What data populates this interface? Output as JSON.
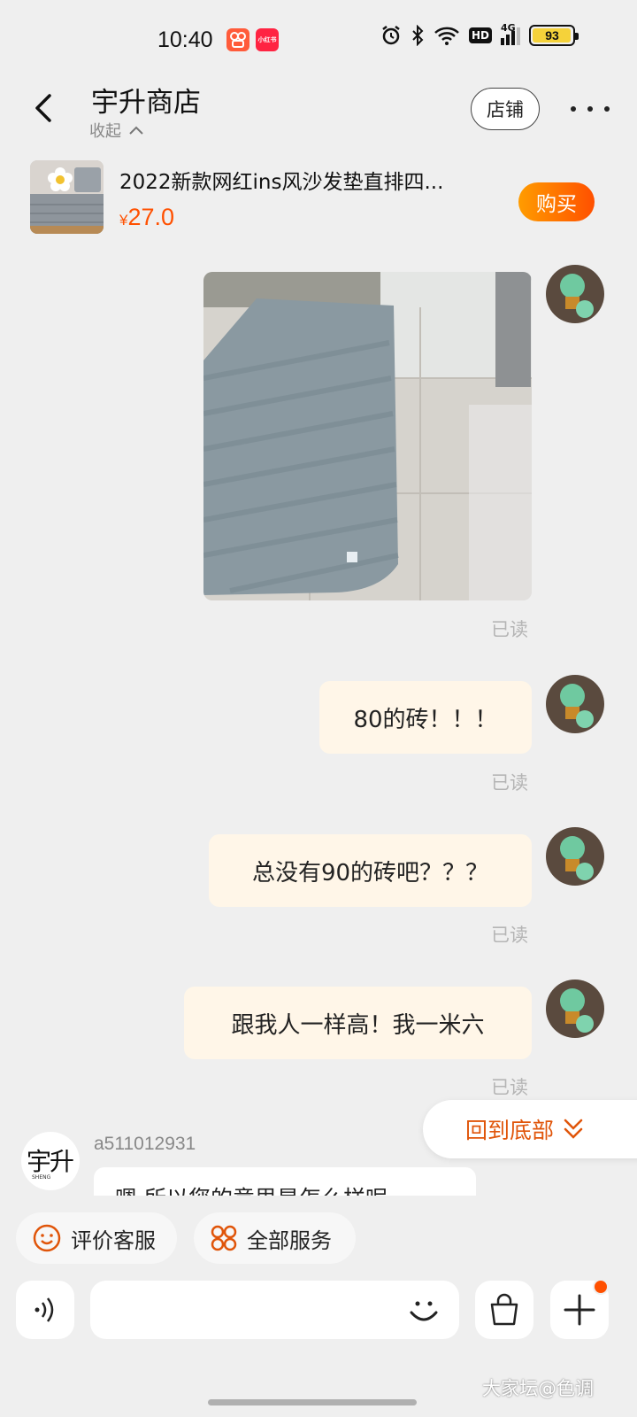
{
  "status_bar": {
    "time": "10:40",
    "battery": "93",
    "network": "4G",
    "hd_label": "HD",
    "app_icons": [
      "kuaishou-icon",
      "xiaohongshu-icon"
    ],
    "xiaohongshu_label": "小红书"
  },
  "header": {
    "title": "宇升商店",
    "collapse_label": "收起",
    "store_button": "店铺"
  },
  "product": {
    "title": "2022新款网红ins风沙发垫直排四...",
    "price_symbol": "¥",
    "price": "27.0",
    "buy_button": "购买"
  },
  "messages": [
    {
      "type": "image",
      "sender": "me",
      "status": "已读"
    },
    {
      "type": "text",
      "sender": "me",
      "text": "80的砖！！！",
      "status": "已读"
    },
    {
      "type": "text",
      "sender": "me",
      "text": "总没有90的砖吧？？？",
      "status": "已读"
    },
    {
      "type": "text",
      "sender": "me",
      "text": "跟我人一样高！我一米六",
      "status": "已读"
    }
  ],
  "seller": {
    "id": "a511012931",
    "avatar_text": "宇升",
    "avatar_subtext": "SHENG",
    "partial_message": "嗯 所以您的意思是怎么样呢"
  },
  "back_to_bottom": "回到底部",
  "quick_actions": {
    "rate": "评价客服",
    "services": "全部服务"
  },
  "watermark": "大家坛@色调",
  "colors": {
    "accent": "#ff5000",
    "bubble_out": "#fff6e8",
    "background": "#efefef"
  }
}
